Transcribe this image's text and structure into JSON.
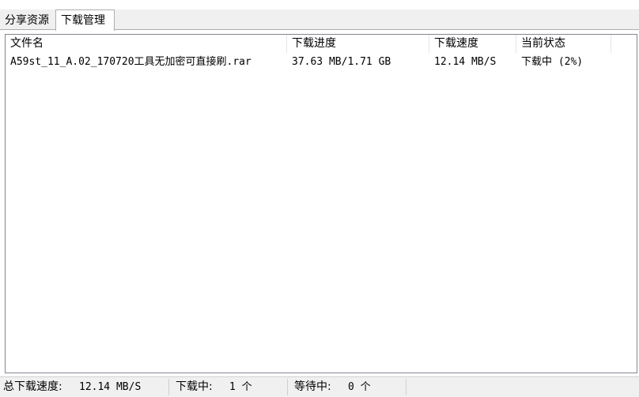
{
  "tabs": [
    {
      "label": "分享资源",
      "active": false
    },
    {
      "label": "下载管理",
      "active": true
    }
  ],
  "download_list": {
    "columns": [
      "文件名",
      "下载进度",
      "下载速度",
      "当前状态"
    ],
    "rows": [
      {
        "filename": "A59st_11_A.02_170720工具无加密可直接刷.rar",
        "progress": "37.63 MB/1.71 GB",
        "speed": "12.14 MB/S",
        "status": "下载中 (2%)"
      }
    ]
  },
  "status_bar": {
    "total_speed_label": "总下载速度:",
    "total_speed_value": "12.14 MB/S",
    "downloading_label": "下载中:",
    "downloading_value": "1 个",
    "waiting_label": "等待中:",
    "waiting_value": "0 个"
  }
}
